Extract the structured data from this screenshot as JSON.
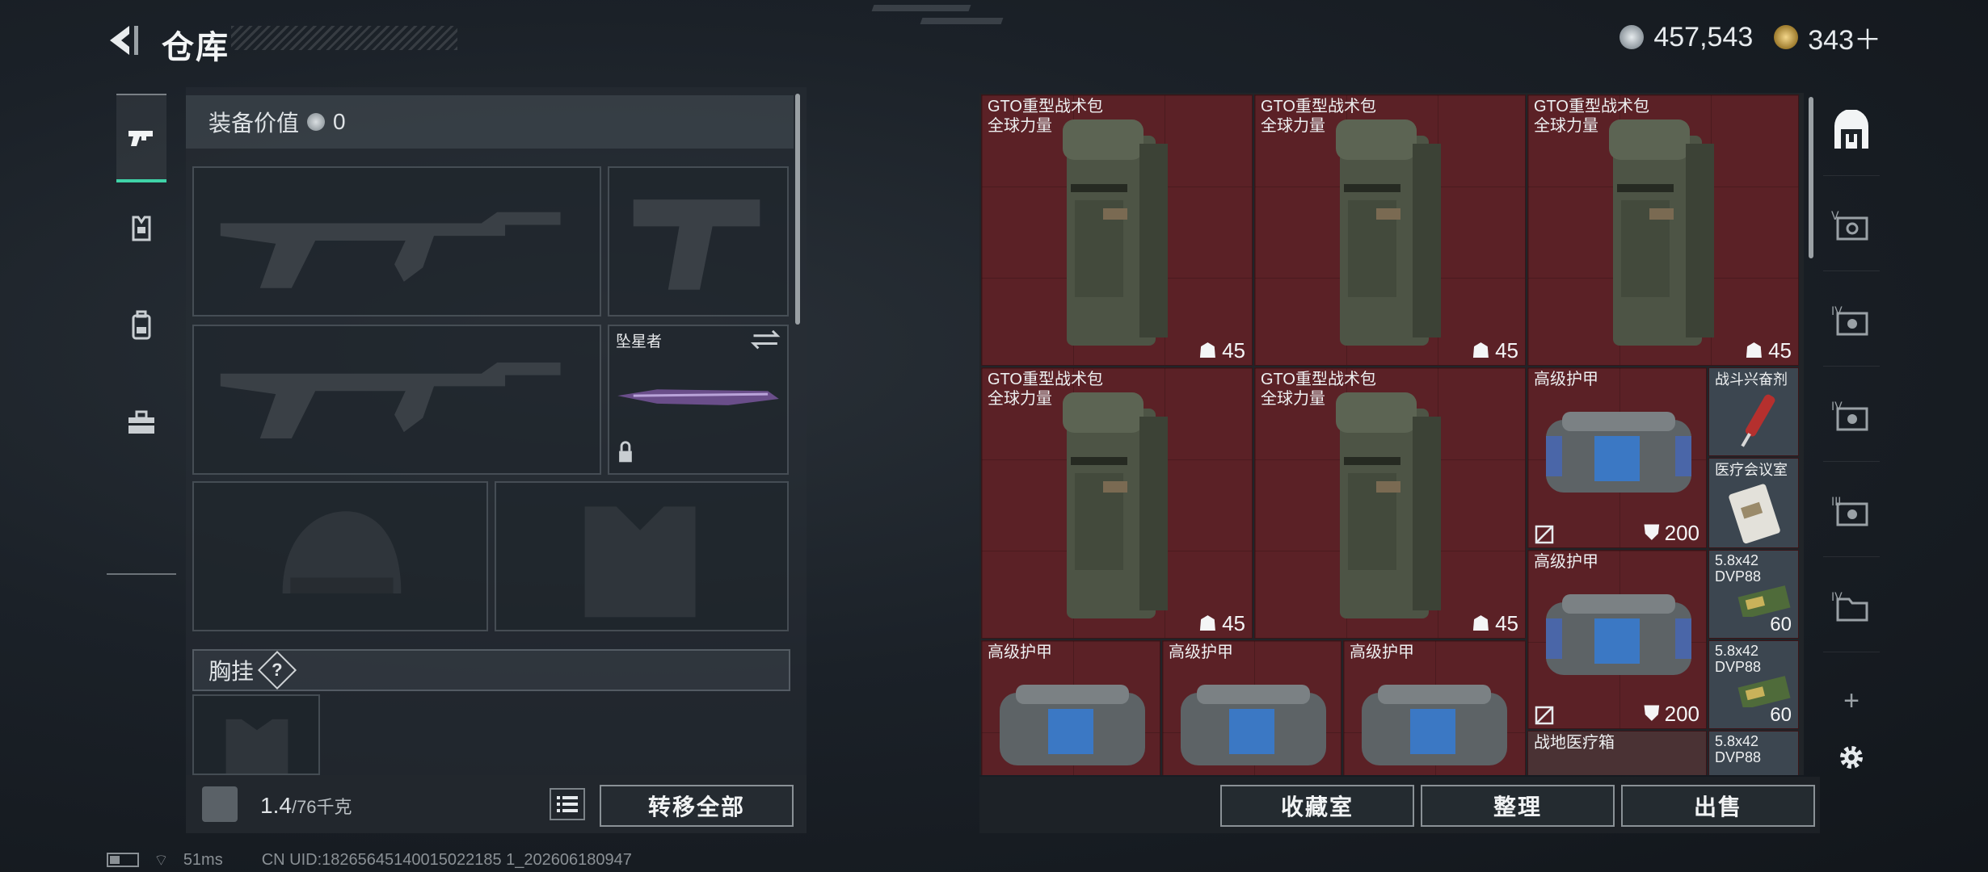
{
  "header": {
    "title": "仓库"
  },
  "currency": {
    "coins": "457,543",
    "premium": "343＋",
    "coin_color": "#b9c0c6",
    "premium_color": "#c9a24a"
  },
  "left_tabs": [
    {
      "icon": "pistol-icon",
      "active": true
    },
    {
      "icon": "armor-vest-icon"
    },
    {
      "icon": "backpack-icon"
    },
    {
      "icon": "toolbox-icon"
    }
  ],
  "equipment": {
    "value_label": "装备价值",
    "value": "0",
    "melee_name": "坠星者",
    "chest_rig_label": "胸挂",
    "help_symbol": "?"
  },
  "inventory": {
    "weight_current": "1.4",
    "weight_max": "/76千克",
    "transfer_all": "转移全部"
  },
  "stash": {
    "items": [
      {
        "name": "GTO重型战术包\n全球力量",
        "count": "45"
      },
      {
        "name": "GTO重型战术包\n全球力量",
        "count": "45"
      },
      {
        "name": "GTO重型战术包\n全球力量",
        "count": "45"
      },
      {
        "name": "GTO重型战术包\n全球力量",
        "count": "45"
      },
      {
        "name": "GTO重型战术包\n全球力量",
        "count": "45"
      },
      {
        "name": "高级护甲",
        "count": "200"
      },
      {
        "name": "战斗兴奋剂",
        "count": ""
      },
      {
        "name": "医疗会议室",
        "count": ""
      },
      {
        "name": "高级护甲",
        "count": "200"
      },
      {
        "name": "5.8x42\nDVP88",
        "count": "60"
      },
      {
        "name": "5.8x42\nDVP88",
        "count": "60"
      },
      {
        "name": "高级护甲",
        "count": ""
      },
      {
        "name": "高级护甲",
        "count": ""
      },
      {
        "name": "高级护甲",
        "count": ""
      },
      {
        "name": "战地医疗箱",
        "count": ""
      },
      {
        "name": "5.8x42\nDVP88",
        "count": ""
      }
    ],
    "item_bg_color": "#5b2126"
  },
  "right_tabs": [
    {
      "icon": "stash-home-icon",
      "active": true
    },
    {
      "icon": "vault-v-icon"
    },
    {
      "icon": "vault-iv-icon"
    },
    {
      "icon": "vault-iv-b-icon"
    },
    {
      "icon": "vault-iii-icon"
    },
    {
      "icon": "folder-iv-icon"
    },
    {
      "icon": "plus-icon",
      "label": "+"
    },
    {
      "icon": "gear-icon"
    }
  ],
  "actions": {
    "collection": "收藏室",
    "organize": "整理",
    "sell": "出售"
  },
  "status": {
    "ping": "51ms",
    "uid": "CN UID:18265645140015022185 1_202606180947"
  }
}
